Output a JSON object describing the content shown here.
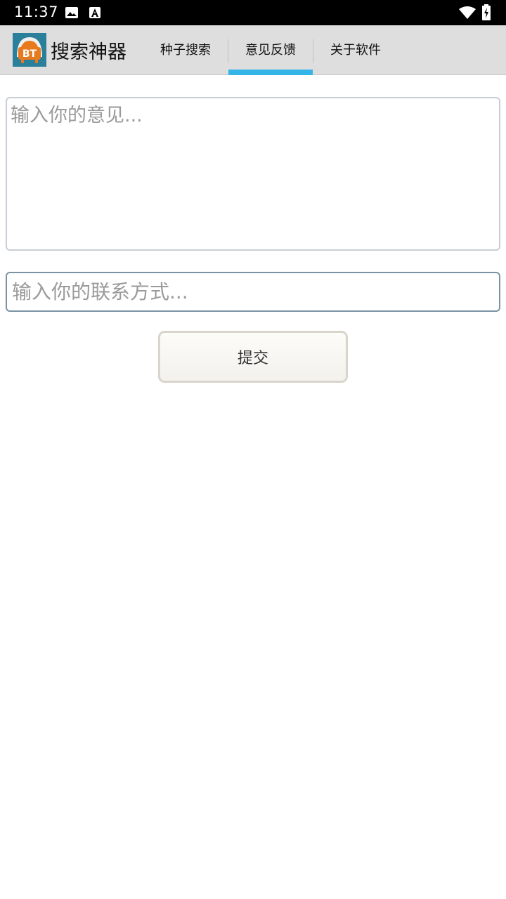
{
  "status_bar": {
    "time": "11:37",
    "icons": [
      "image-icon",
      "font-icon",
      "wifi-icon",
      "battery-icon"
    ]
  },
  "app_bar": {
    "logo_text": "BT",
    "title": "搜索神器",
    "tabs": [
      {
        "label": "种子搜索",
        "active": false
      },
      {
        "label": "意见反馈",
        "active": true
      },
      {
        "label": "关于软件",
        "active": false
      }
    ],
    "accent_color": "#35b4e8"
  },
  "form": {
    "opinion_placeholder": "输入你的意见...",
    "opinion_value": "",
    "contact_placeholder": "输入你的联系方式...",
    "contact_value": "",
    "submit_label": "提交"
  }
}
